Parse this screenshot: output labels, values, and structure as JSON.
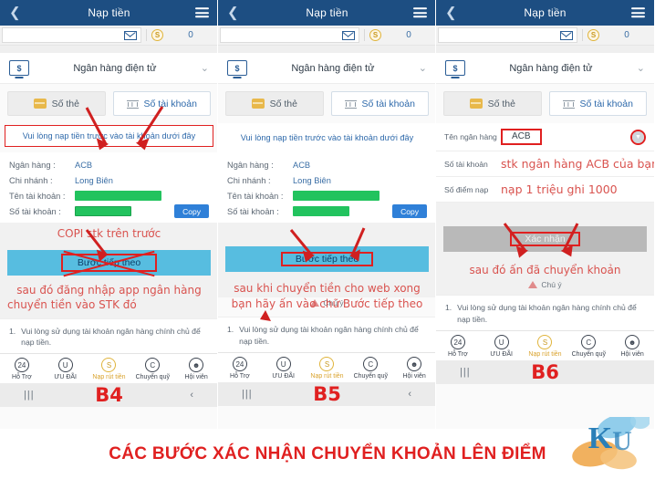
{
  "caption": {
    "text": "CÁC BƯỚC XÁC NHẬN CHUYỂN KHOẢN LÊN ĐIỂM",
    "color": "#e02020",
    "logo_text": "KU"
  },
  "common": {
    "appbar": {
      "title": "Nạp tiền",
      "back_icon": "chevron-left-icon",
      "menu_icon": "hamburger-icon"
    },
    "balance": {
      "envelope_icon": "envelope-icon",
      "coin_icon": "coin-dollar-icon",
      "coin_symbol": "S",
      "amount": "0"
    },
    "method": {
      "icon": "monitor-dollar-icon",
      "icon_symbol": "$",
      "label": "Ngân hàng điện tử",
      "chevron": "⌄"
    },
    "tabs": [
      {
        "label": "Số thẻ",
        "icon": "credit-card-icon",
        "selected": true
      },
      {
        "label": "Số tài khoản",
        "icon": "bank-icon",
        "selected": false
      }
    ],
    "note": {
      "number": "1.",
      "text": "Vui lòng sử dụng tài khoản ngân hàng chính chủ để nạp tiền."
    },
    "bottom_nav": [
      {
        "label": "Hỗ Trợ",
        "icon": "support-24-icon",
        "glyph": "24",
        "active": false
      },
      {
        "label": "ƯU ĐÃI",
        "icon": "promo-u-icon",
        "glyph": "U",
        "active": false
      },
      {
        "label": "Nạp rút tiền",
        "icon": "deposit-dollar-icon",
        "glyph": "S",
        "active": true
      },
      {
        "label": "Chuyển quỹ",
        "icon": "transfer-c-icon",
        "glyph": "C",
        "active": false
      },
      {
        "label": "Hội viên",
        "icon": "member-person-icon",
        "glyph": "person",
        "active": false
      }
    ],
    "sysbar": {
      "recent_icon": "recent-apps-icon",
      "recent_glyph": "|||",
      "back_icon": "android-back-icon",
      "back_glyph": "‹"
    },
    "warning": {
      "icon": "warning-triangle-icon",
      "label": "Chú ý"
    }
  },
  "panel1": {
    "step_label": "B4",
    "notice": "Vui lòng nạp tiền trước vào tài khoản dưới đây",
    "notice_boxed": true,
    "info_rows": [
      {
        "key": "Ngân hàng :",
        "value": "ACB",
        "redacted": false
      },
      {
        "key": "Chi nhánh :",
        "value": "Long Biên",
        "redacted": false
      },
      {
        "key": "Tên tài khoản :",
        "value": "",
        "redacted": true,
        "redact_width": "w1"
      },
      {
        "key": "Số tài khoản :",
        "value": "",
        "redacted": true,
        "redact_width": "w2"
      }
    ],
    "copy_label": "Copy",
    "annotation_above": "COPI stk trên trước",
    "action_button": {
      "label": "Bước tiếp theo",
      "style": "blue",
      "crossed_out": true
    },
    "annotation_below_1": "sau đó đăng nhập app ngân hàng",
    "annotation_below_2": "chuyển tiền vào STK đó"
  },
  "panel2": {
    "step_label": "B5",
    "notice": "Vui lòng nạp tiền trước vào tài khoản dưới đây",
    "notice_boxed": false,
    "info_rows": [
      {
        "key": "Ngân hàng :",
        "value": "ACB",
        "redacted": false
      },
      {
        "key": "Chi nhánh :",
        "value": "Long Biên",
        "redacted": false
      },
      {
        "key": "Tên tài khoản :",
        "value": "",
        "redacted": true,
        "redact_width": "w1"
      },
      {
        "key": "Số tài khoản :",
        "value": "",
        "redacted": true,
        "redact_width": "w2"
      }
    ],
    "copy_label": "Copy",
    "action_button": {
      "label": "Bước tiếp theo",
      "style": "blue",
      "highlighted": true
    },
    "annotation_below_1": "sau khi chuyển tiền cho web xong",
    "annotation_below_2": "bạn hãy ấn vào chữ Bước tiếp theo"
  },
  "panel3": {
    "step_label": "B6",
    "form_rows": [
      {
        "key": "Tên ngân hàng",
        "value": "ACB",
        "boxed": true,
        "dropdown": true
      },
      {
        "key": "Số tài khoản",
        "hand_value": "stk ngân hàng ACB của bạn"
      },
      {
        "key": "Số điểm nạp",
        "hand_value": "nạp 1 triệu ghi 1000"
      }
    ],
    "action_button": {
      "label": "Xác nhận",
      "style": "grey",
      "highlighted": true
    },
    "annotation_below_1": "sau đó ấn đã chuyển khoản"
  }
}
